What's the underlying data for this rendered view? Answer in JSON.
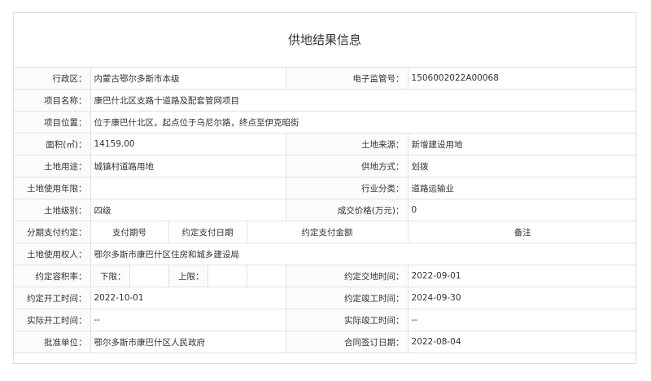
{
  "title": "供地结果信息",
  "rows": {
    "district": {
      "label": "行政区：",
      "value": "内蒙古鄂尔多斯市本级"
    },
    "supervision_no": {
      "label": "电子监管号：",
      "value": "1506002022A00068"
    },
    "project_name": {
      "label": "项目名称：",
      "value": "康巴什北区支路十道路及配套管网项目"
    },
    "project_location": {
      "label": "项目位置：",
      "value": "位于康巴什北区，起点位于乌尼尔路，终点至伊克昭街"
    },
    "area": {
      "label": "面积(㎡)：",
      "value": "14159.00"
    },
    "land_source": {
      "label": "土地来源：",
      "value": "新增建设用地"
    },
    "land_use": {
      "label": "土地用途：",
      "value": "城镇村道路用地"
    },
    "supply_method": {
      "label": "供地方式：",
      "value": "划拨"
    },
    "use_years": {
      "label": "土地使用年限：",
      "value": ""
    },
    "industry": {
      "label": "行业分类：",
      "value": "道路运输业"
    },
    "land_grade": {
      "label": "土地级别：",
      "value": "四级"
    },
    "price": {
      "label": "成交价格(万元)：",
      "value": "0"
    },
    "installments": {
      "label": "分期支付约定：",
      "headers": [
        "支付期号",
        "约定支付日期",
        "约定支付金额",
        "备注"
      ]
    },
    "land_user": {
      "label": "土地使用权人：",
      "value": "鄂尔多斯市康巴什区住房和城乡建设局"
    },
    "plot_ratio": {
      "label": "约定容积率：",
      "lower_label": "下限：",
      "lower_value": "",
      "upper_label": "上限：",
      "upper_value": ""
    },
    "handover_date": {
      "label": "约定交地时间：",
      "value": "2022-09-01"
    },
    "start_date": {
      "label": "约定开工时间：",
      "value": "2022-10-01"
    },
    "completion_date": {
      "label": "约定竣工时间：",
      "value": "2024-09-30"
    },
    "actual_start": {
      "label": "实际开工时间：",
      "value": "--"
    },
    "actual_completion": {
      "label": "实际竣工时间：",
      "value": "--"
    },
    "approval_unit": {
      "label": "批准单位：",
      "value": "鄂尔多斯市康巴什区人民政府"
    },
    "contract_date": {
      "label": "合同签订日期：",
      "value": "2022-08-04"
    }
  }
}
